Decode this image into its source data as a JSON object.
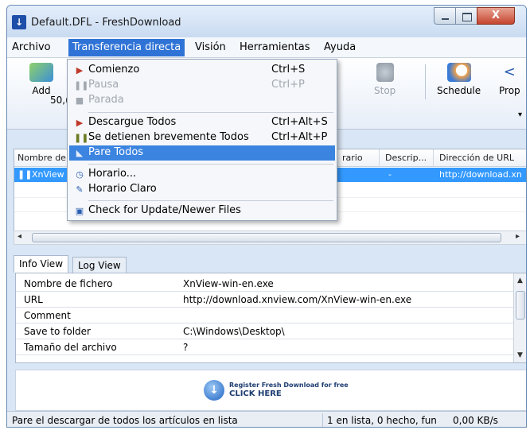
{
  "window": {
    "title": "Default.DFL - FreshDownload"
  },
  "menubar": {
    "items": [
      {
        "label": "Archivo"
      },
      {
        "label": "Transferencia directa"
      },
      {
        "label": "Visión"
      },
      {
        "label": "Herramientas"
      },
      {
        "label": "Ayuda"
      }
    ]
  },
  "toolbar": {
    "add_label": "Add",
    "stop_label": "Stop",
    "schedule_label": "Schedule",
    "prop_label": "Prop",
    "speed_text": "50,("
  },
  "dropdown": {
    "items": [
      {
        "label": "Comienzo",
        "shortcut": "Ctrl+S",
        "icon": "play-icon",
        "state": "enabled"
      },
      {
        "label": "Pausa",
        "shortcut": "Ctrl+P",
        "icon": "pause-icon",
        "state": "disabled"
      },
      {
        "label": "Parada",
        "shortcut": "",
        "icon": "stop-icon",
        "state": "disabled"
      },
      {
        "label": "Descargue Todos",
        "shortcut": "Ctrl+Alt+S",
        "icon": "download-all-icon",
        "state": "enabled"
      },
      {
        "label": "Se detienen brevemente Todos",
        "shortcut": "Ctrl+Alt+P",
        "icon": "pause-all-icon",
        "state": "enabled"
      },
      {
        "label": "Pare Todos",
        "shortcut": "",
        "icon": "stop-all-icon",
        "state": "highlighted"
      },
      {
        "label": "Horario...",
        "shortcut": "",
        "icon": "clock-icon",
        "state": "enabled"
      },
      {
        "label": "Horario Claro",
        "shortcut": "",
        "icon": "clear-schedule-icon",
        "state": "enabled"
      },
      {
        "label": "Check for Update/Newer Files",
        "shortcut": "",
        "icon": "update-check-icon",
        "state": "enabled"
      }
    ]
  },
  "list": {
    "columns": [
      "Nombre de",
      "rario",
      "Descrip...",
      "Dirección de URL"
    ],
    "rows": [
      {
        "name": "XnView",
        "desc": "-",
        "url": "http://download.xn"
      }
    ]
  },
  "tabs": [
    {
      "label": "Info View",
      "active": true
    },
    {
      "label": "Log View",
      "active": false
    }
  ],
  "info": {
    "rows": [
      {
        "key": "Nombre de fichero",
        "value": "XnView-win-en.exe"
      },
      {
        "key": "URL",
        "value": "http://download.xnview.com/XnView-win-en.exe"
      },
      {
        "key": "Comment",
        "value": ""
      },
      {
        "key": "Save to folder",
        "value": "C:\\Windows\\Desktop\\"
      },
      {
        "key": "Tamaño del archivo",
        "value": "?"
      }
    ]
  },
  "banner": {
    "line1": "Register Fresh Download for free",
    "line2": "CLICK HERE"
  },
  "status": {
    "left": "Pare el descargar de todos los artículos en lista",
    "middle": "1 en lista, 0 hecho, fun",
    "right": "0,00 KB/s"
  },
  "colors": {
    "menu_highlight": "#2f73d6",
    "selection": "#3399ff",
    "dropdown_highlight": "#3b84e0"
  }
}
